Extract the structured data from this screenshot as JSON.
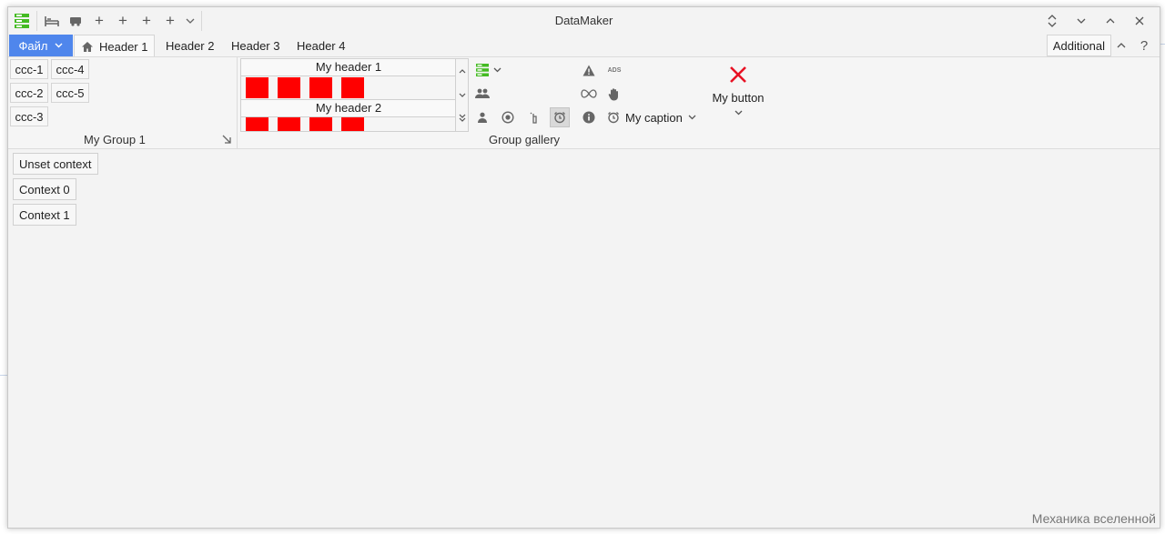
{
  "window": {
    "title": "DataMaker"
  },
  "file_tab": {
    "label": "Файл"
  },
  "tabs": [
    {
      "label": "Header 1",
      "active": true
    },
    {
      "label": "Header 2",
      "active": false
    },
    {
      "label": "Header 3",
      "active": false
    },
    {
      "label": "Header 4",
      "active": false
    }
  ],
  "additional": {
    "label": "Additional"
  },
  "groups": {
    "my_group": {
      "label": "My Group 1",
      "buttons": [
        "ccc-1",
        "ccc-4",
        "ccc-2",
        "ccc-5",
        "ccc-3"
      ]
    },
    "gallery": {
      "label": "Group gallery",
      "header1": "My header 1",
      "header2": "My header 2"
    },
    "small": {
      "caption": "My caption",
      "ads_label": "ADS"
    },
    "big_button": {
      "label": "My button"
    }
  },
  "context_buttons": [
    "Unset context",
    "Context 0",
    "Context 1"
  ],
  "status": "Механика вселенной",
  "colors": {
    "accent": "#4f86ec",
    "gallery_item": "#ff0000",
    "close_x": "#e81123",
    "green_icon": "#44bb22"
  }
}
